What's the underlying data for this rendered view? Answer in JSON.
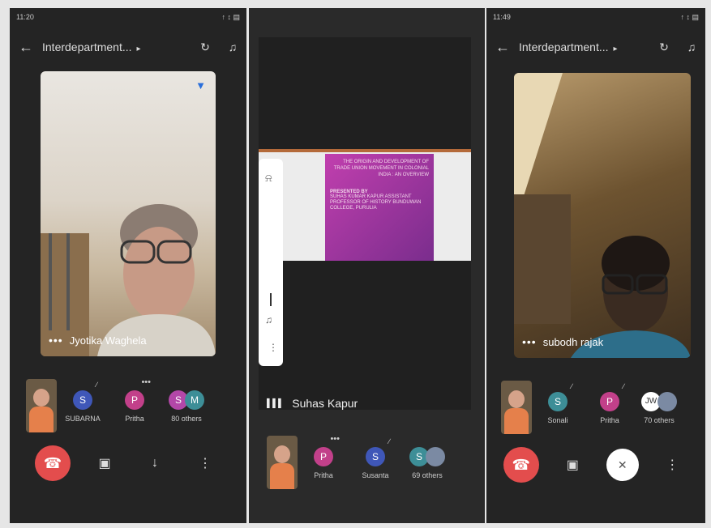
{
  "p1": {
    "time": "11:20",
    "signal": "↑ ↕ ▤",
    "title": "Interdepartment...",
    "speaker": "Jyotika Waghela",
    "participants": [
      {
        "initial": "S",
        "label": "SUBARNA",
        "color": "#3f57b8"
      },
      {
        "initial": "P",
        "label": "Pritha",
        "color": "#c2408a"
      }
    ],
    "others": {
      "initials": [
        "S",
        "M"
      ],
      "colors": [
        "#b347a8",
        "#3d8e97"
      ],
      "label": "80 others"
    }
  },
  "p2": {
    "slide": {
      "title": "THE ORIGIN AND DEVELOPMENT OF TRADE UNION MOVEMENT IN COLONIAL INDIA : AN OVERVIEW",
      "presented": "PRESENTED BY",
      "byline": "SUHAS KUMAR KAPUR ASSISTANT PROFESSOR OF HISTORY BUNDUWAN COLLEGE, PURULIA"
    },
    "presenter": "Suhas Kapur",
    "participants": [
      {
        "initial": "P",
        "label": "Pritha",
        "color": "#c2408a"
      },
      {
        "initial": "S",
        "label": "Susanta",
        "color": "#3f57b8"
      }
    ],
    "others": {
      "initials": [
        "S"
      ],
      "colors": [
        "#3d8e97"
      ],
      "label": "69 others"
    }
  },
  "p3": {
    "time": "11:49",
    "signal": "↑ ↕ ▤",
    "title": "Interdepartment...",
    "speaker": "subodh rajak",
    "participants": [
      {
        "initial": "S",
        "label": "Sonali",
        "color": "#3d8e97"
      },
      {
        "initial": "P",
        "label": "Pritha",
        "color": "#c2408a"
      }
    ],
    "others": {
      "initials": [
        "JW"
      ],
      "colors": [
        "#ffffff"
      ],
      "label": "70 others"
    }
  },
  "icons": {
    "back": "←",
    "caret": "▸",
    "camera_switch": "↻",
    "speaker": "♫",
    "end_call": "☎",
    "video": "▣",
    "mic": "↓",
    "more": "⋮",
    "mic_off": "✕",
    "dots": "•••",
    "bars": "▌▌▌",
    "mute": "∕"
  }
}
